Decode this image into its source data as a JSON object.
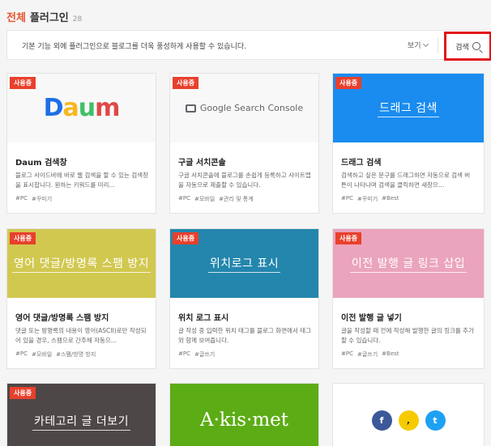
{
  "header": {
    "title_accent": "전체",
    "title_main": "플러그인",
    "count": "28"
  },
  "infobar": {
    "text": "기본 기능 외에 플러그인으로 블로그를 더욱 풍성하게 사용할 수 있습니다.",
    "view_label": "보기",
    "search_label": "검색"
  },
  "badge_label": "사용중",
  "cards": [
    {
      "thumb_text": "Daum",
      "title": "Daum 검색창",
      "desc": "블로그 사이드바에 바로 웹 검색을 할 수 있는 검색창을 표시합니다. 원하는 키워드를 미리…",
      "tags": [
        "#PC",
        "#꾸미기"
      ]
    },
    {
      "thumb_text": "Google Search Console",
      "title": "구글 서치콘솔",
      "desc": "구글 서치콘솔에 블로그를 손쉽게 등록하고 사이트맵을 자동으로 제출할 수 있습니다.",
      "tags": [
        "#PC",
        "#모바일",
        "#관리 및 통계"
      ]
    },
    {
      "thumb_text": "드래그 검색",
      "title": "드래그 검색",
      "desc": "검색하고 싶은 문구를 드래그하면 자동으로 검색 버튼이 나타나며 검색을 클릭하면 새창으…",
      "tags": [
        "#PC",
        "#꾸미기",
        "#Best"
      ]
    },
    {
      "thumb_text": "영어 댓글/방명록 스팸 방지",
      "title": "영어 댓글/방명록 스팸 방지",
      "desc": "댓글 또는 방명록의 내용이 영어(ASCII)로만 작성되어 있을 경우, 스팸으로 간주해 자동으…",
      "tags": [
        "#PC",
        "#모바일",
        "#스팸/방명 방지"
      ]
    },
    {
      "thumb_text": "위치로그 표시",
      "title": "위치 로그 표시",
      "desc": "글 작성 중 입력한 위치 태그를 블로그 화면에서 태그와 함께 보여줍니다.",
      "tags": [
        "#PC",
        "#글쓰기"
      ]
    },
    {
      "thumb_text": "이전 발행 글 링크 삽입",
      "title": "이전 발행 글 넣기",
      "desc": "글을 작성할 때 전에 작성해 발행한 글의 링크를 추가할 수 있습니다.",
      "tags": [
        "#PC",
        "#글쓰기",
        "#Best"
      ]
    },
    {
      "thumb_text": "카테고리 글 더보기"
    },
    {
      "thumb_text": "A·kis·met"
    },
    {
      "social": [
        "f",
        ",",
        "t"
      ]
    }
  ]
}
